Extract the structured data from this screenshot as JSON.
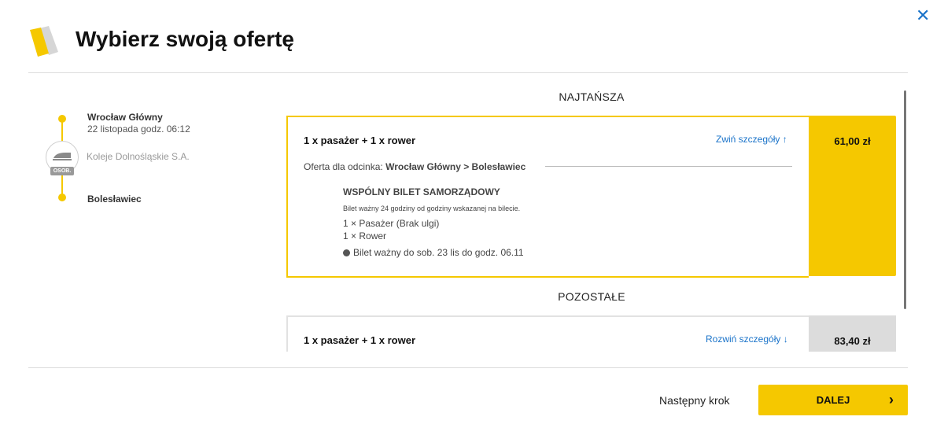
{
  "header": {
    "title": "Wybierz swoją ofertę",
    "close_icon": "close-icon"
  },
  "route": {
    "from_station": "Wrocław Główny",
    "from_date": "22 listopada godz. 06:12",
    "carrier": "Koleje Dolnośląskie S.A.",
    "train_badge": "OSOB.",
    "to_station": "Bolesławiec"
  },
  "sections": {
    "cheapest": "NAJTAŃSZA",
    "others": "POZOSTAŁE"
  },
  "offers": [
    {
      "title": "1 x pasażer + 1 x rower",
      "toggle": "Zwiń szczegóły",
      "toggle_arrow": "↑",
      "price": "61,00 zł",
      "segment_label": "Oferta dla odcinka:",
      "segment_value": "Wrocław Główny > Bolesławiec",
      "ticket_name": "WSPÓLNY BILET SAMORZĄDOWY",
      "ticket_note": "Bilet ważny 24 godziny od godziny wskazanej na bilecie.",
      "item1": "1 × Pasażer (Brak ulgi)",
      "item2": "1 × Rower",
      "validity": "Bilet ważny do sob. 23 lis do godz. 06.11"
    },
    {
      "title": "1 x pasażer + 1 x rower",
      "toggle": "Rozwiń szczegóły",
      "toggle_arrow": "↓",
      "price": "83,40 zł"
    }
  ],
  "footer": {
    "next_step": "Następny krok",
    "button": "DALEJ",
    "button_arrow": "›"
  },
  "colors": {
    "accent": "#f5c800",
    "link": "#1a73c9",
    "grey_price": "#dcdcdc"
  }
}
